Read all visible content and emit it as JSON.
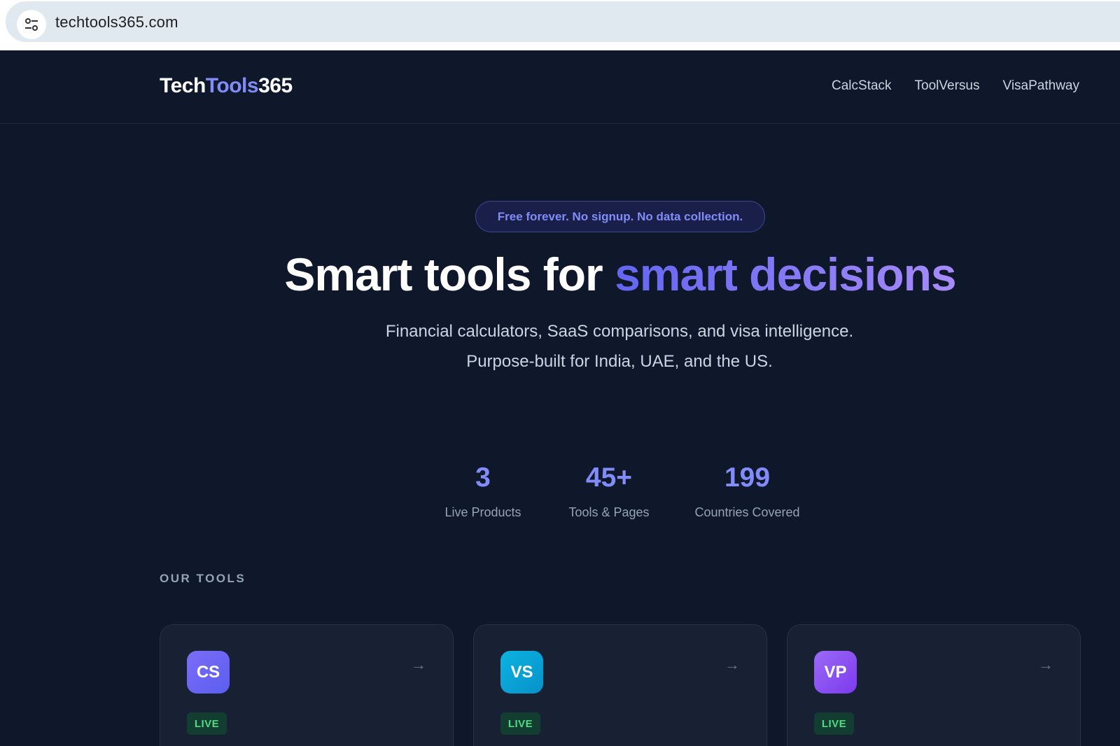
{
  "browser": {
    "url": "techtools365.com",
    "site_icon": "tune-icon"
  },
  "header": {
    "logo": {
      "part1": "Tech",
      "part2": "Tools",
      "part3": "365"
    },
    "nav": [
      {
        "label": "CalcStack"
      },
      {
        "label": "ToolVersus"
      },
      {
        "label": "VisaPathway"
      }
    ]
  },
  "hero": {
    "badge": "Free forever. No signup. No data collection.",
    "title_plain": "Smart tools for ",
    "title_accent": "smart decisions",
    "subtitle_line1": "Financial calculators, SaaS comparisons, and visa intelligence.",
    "subtitle_line2": "Purpose-built for India, UAE, and the US."
  },
  "stats": [
    {
      "value": "3",
      "label": "Live Products"
    },
    {
      "value": "45+",
      "label": "Tools & Pages"
    },
    {
      "value": "199",
      "label": "Countries Covered"
    }
  ],
  "tools_section": {
    "label": "OUR TOOLS",
    "cards": [
      {
        "abbr": "CS",
        "status": "LIVE",
        "arrow": "→",
        "color": "#6d63f1"
      },
      {
        "abbr": "VS",
        "status": "LIVE",
        "arrow": "→",
        "color": "#0ea5d9"
      },
      {
        "abbr": "VP",
        "status": "LIVE",
        "arrow": "→",
        "color": "#8b5cf6"
      }
    ]
  },
  "colors": {
    "page_bg": "#0f172a",
    "accent": "#818cf8",
    "live_green": "#4ade80"
  }
}
